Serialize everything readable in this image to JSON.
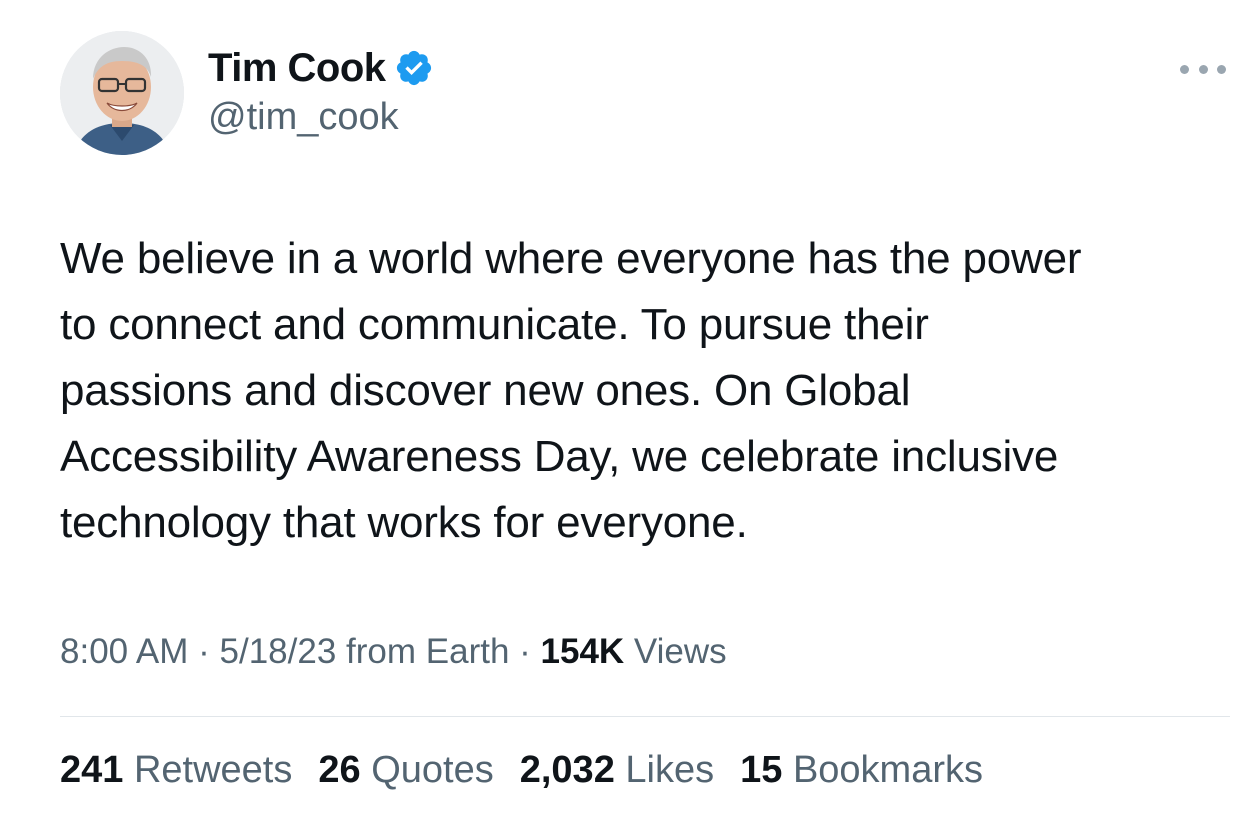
{
  "author": {
    "display_name": "Tim Cook",
    "handle": "@tim_cook",
    "avatar_icon": "profile-photo",
    "verified_icon": "verified-badge-icon",
    "verified_color": "#1d9bf0"
  },
  "more_icon": "more-options-icon",
  "tweet": {
    "text": "We believe in a world where everyone has the power\nto connect and communicate. To pursue their\npassions and discover new ones. On Global\nAccessibility Awareness Day, we celebrate inclusive\ntechnology that works for everyone."
  },
  "meta": {
    "time": "8:00 AM",
    "sep1": " · ",
    "date": "5/18/23",
    "source": " from Earth",
    "sep2": " · ",
    "views_count": "154K",
    "views_label": " Views"
  },
  "stats": {
    "retweets_count": "241",
    "retweets_label": " Retweets",
    "quotes_count": "26",
    "quotes_label": " Quotes",
    "likes_count": "2,032",
    "likes_label": " Likes",
    "bookmarks_count": "15",
    "bookmarks_label": " Bookmarks"
  },
  "colors": {
    "text_primary": "#0f1419",
    "text_secondary": "#536471",
    "divider": "#e1e6ea"
  }
}
